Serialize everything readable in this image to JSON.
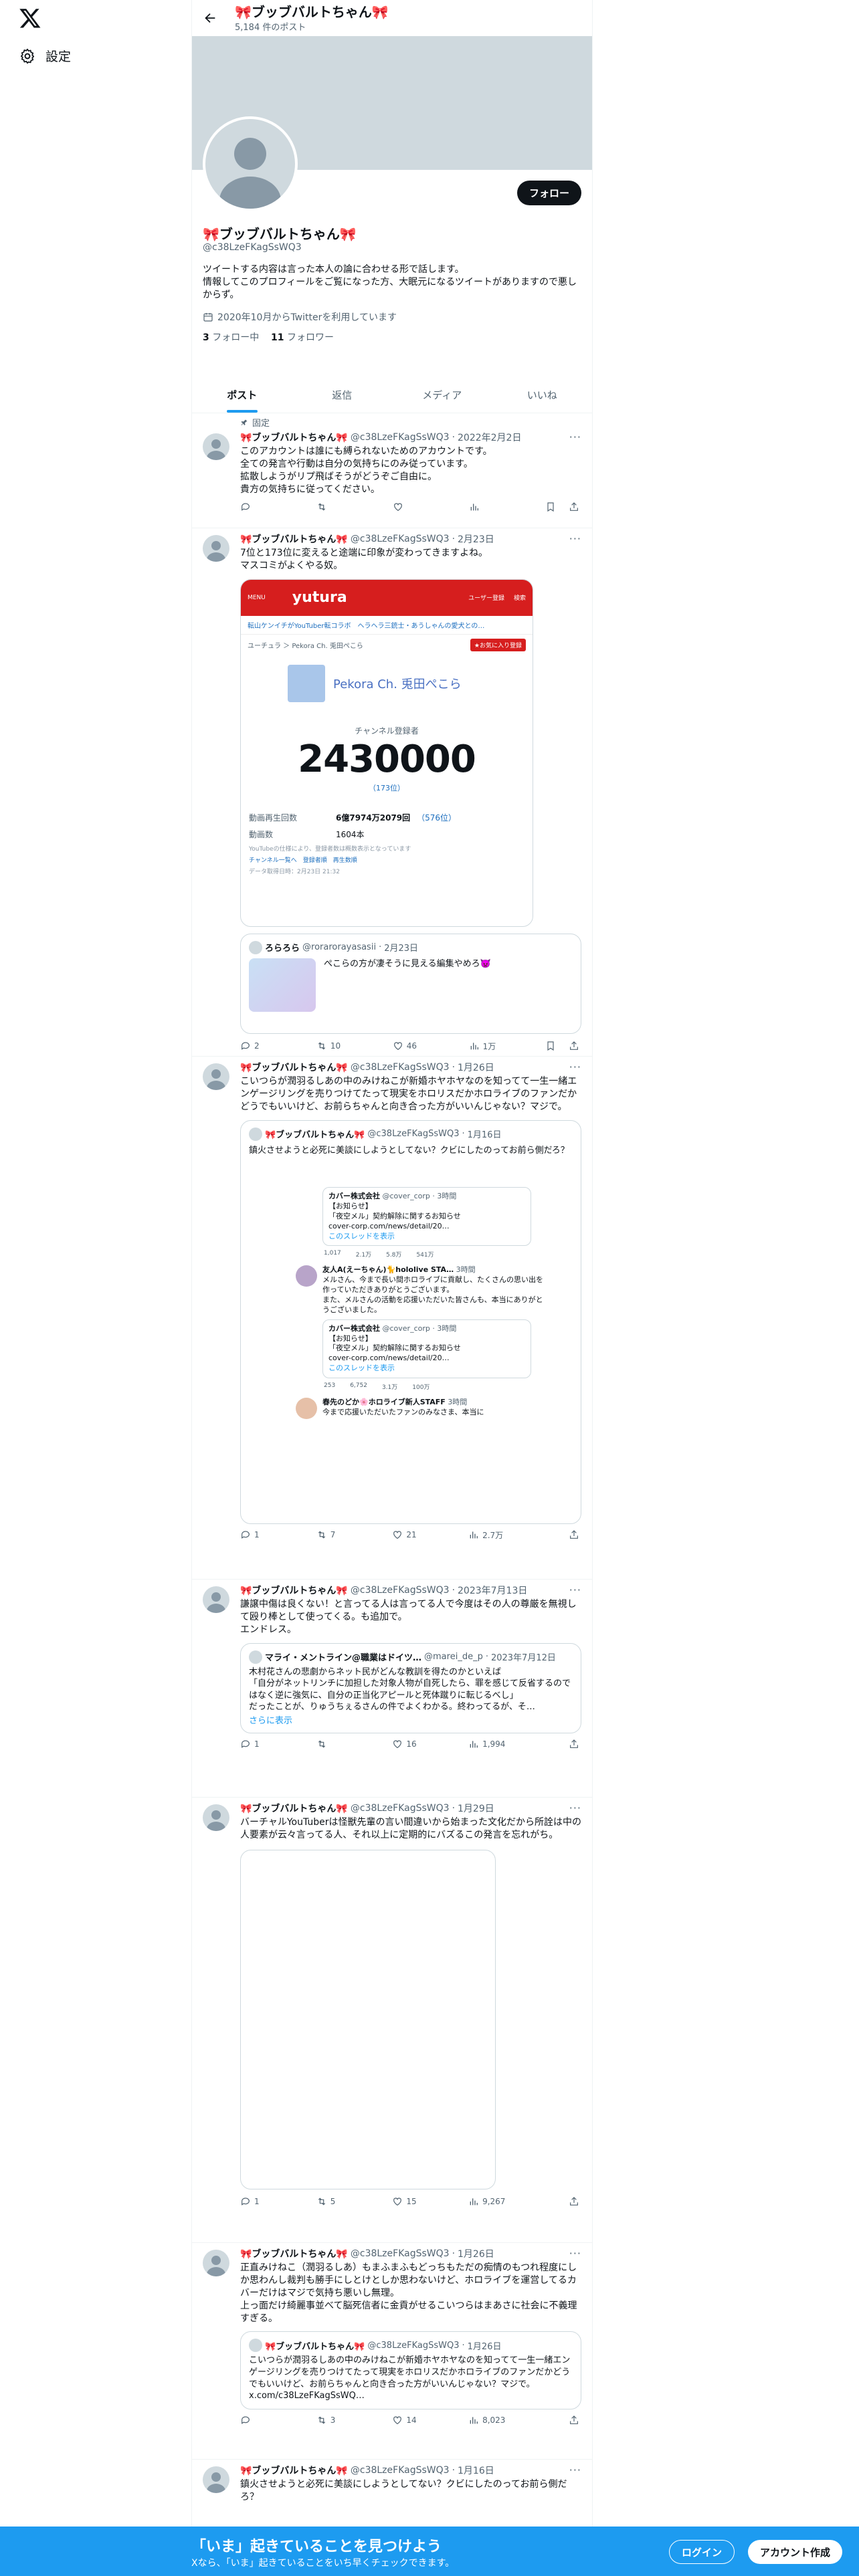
{
  "sidebar": {
    "settings_label": "設定"
  },
  "header": {
    "title": "🎀ブッブバルトちゃん🎀",
    "post_count": "5,184 件のポスト"
  },
  "profile": {
    "follow_label": "フォロー",
    "name": "🎀ブッブバルトちゃん🎀",
    "handle": "@c38LzeFKagSsWQ3",
    "bio": [
      "ツイートする内容は言った本人の論に合わせる形で話します。",
      "情報してこのプロフィールをご覧になった方、大眠元になるツイートがありますので悪しからず。"
    ],
    "joined": "2020年10月からTwitterを利用しています",
    "following_count": "3",
    "following_label": "フォロー中",
    "followers_count": "11",
    "followers_label": "フォロワー"
  },
  "tabs": [
    {
      "label": "ポスト"
    },
    {
      "label": "返信"
    },
    {
      "label": "メディア"
    },
    {
      "label": "いいね"
    }
  ],
  "pinned_label": "固定",
  "tweets": [
    {
      "name": "🎀ブッブバルトちゃん🎀",
      "handle": "@c38LzeFKagSsWQ3",
      "date": "2022年2月2日",
      "text": "このアカウントは誰にも縛られないためのアカウントです。\n全ての発言や行動は自分の気持ちにのみ従っています。\n拡散しようがリプ飛ばそうがどうぞご自由に。\n貴方の気持ちに従ってください。"
    },
    {
      "name": "🎀ブッブバルトちゃん🎀",
      "handle": "@c38LzeFKagSsWQ3",
      "date": "2月23日",
      "text": "7位と173位に変えると途端に印象が変わってきますよね。\nマスコミがよくやる奴。",
      "card": {
        "logo": "yutura",
        "user_label": "ユーザー登録",
        "search_label": "検索",
        "menu_label": "MENU",
        "nav": "転山ケンイチがYouTuber転コラボ　ヘラヘラ三銃士・あうしゃんの愛犬との…",
        "crumb": "ユーチュラ ＞ Pekora Ch. 兎田ぺこら",
        "fav_label": "★お気に入り登録",
        "channel": "Pekora Ch. 兎田ぺこら",
        "sub_label": "チャンネル登録者",
        "subscribers": "2430000",
        "rank": "（173位）",
        "views_label": "動画再生回数",
        "views_value": "6億7974万2079回",
        "views_rank": "（576位）",
        "videos_label": "動画数",
        "videos_value": "1604本",
        "note1": "YouTubeの仕様により、登録者数は概数表示となっています",
        "note2": "チャンネル一覧へ　登録者順　再生数順",
        "note3": "データ取得日時：2月23日 21:32"
      },
      "quote": {
        "name": "ろらろら",
        "handle": "@rorarorayasasii",
        "date": "2月23日",
        "text": "ぺこらの方が凄そうに見える編集やめろ👿"
      },
      "stats": {
        "reply": "2",
        "rt": "10",
        "like": "46",
        "views": "1万"
      }
    },
    {
      "name": "🎀ブッブバルトちゃん🎀",
      "handle": "@c38LzeFKagSsWQ3",
      "date": "1月26日",
      "text": "こいつらが潤羽るしあの中のみけねこが新婚ホヤホヤなのを知ってて一生一緒エンゲージリングを売りつけてたって現実をホロリスだかホロライブのファンだかどうでもいいけど、お前らちゃんと向き合った方がいいんじゃない？マジで。",
      "quote": {
        "name": "🎀ブッブバルトちゃん🎀",
        "handle": "@c38LzeFKagSsWQ3",
        "date": "1月16日",
        "text": "鎮火させようと必死に美談にしようとしてない？クビにしたのってお前ら側だろ？",
        "sub1": {
          "name": "カバー株式会社",
          "handle": "@cover_corp · 3時間",
          "text": "【お知らせ】\n「夜空メル」契約解除に関するお知らせ\ncover-corp.com/news/detail/20…",
          "link": "このスレッドを表示",
          "stats": [
            "1,017",
            "2.1万",
            "5.8万",
            "541万"
          ]
        },
        "reply": {
          "name": "友人A(えーちゃん)🐈hololive STA…",
          "meta": "3時間",
          "text": "メルさん、今まで長い間ホロライブに貢献し、たくさんの思い出を作っていただきありがとうございます。\nまた、メルさんの活動を応援いただいた皆さんも、本当にありがとうございました。"
        },
        "sub2": {
          "name": "カバー株式会社",
          "handle": "@cover_corp · 3時間",
          "text": "【お知らせ】\n「夜空メル」契約解除に関するお知らせ\ncover-corp.com/news/detail/20…",
          "link": "このスレッドを表示",
          "stats": [
            "253",
            "6,752",
            "3.1万",
            "100万"
          ]
        },
        "reply2": {
          "name": "春先のどか🌸ホロライブ新人STAFF",
          "meta": "3時間",
          "text": "今まで応援いただいたファンのみなさま、本当に"
        }
      },
      "stats": {
        "reply": "1",
        "rt": "7",
        "like": "21",
        "views": "2.7万"
      }
    },
    {
      "name": "🎀ブッブバルトちゃん🎀",
      "handle": "@c38LzeFKagSsWQ3",
      "date": "2023年7月13日",
      "text": "謙譲中傷は良くない！と言ってる人は言ってる人で今度はその人の尊厳を無視して殴り棒として使ってくる。も追加で。\nエンドレス。",
      "quote": {
        "name": "マライ・メントライン@職業はドイツ…",
        "handle": "@marei_de_p",
        "date": "2023年7月12日",
        "text": "木村花さんの悲劇からネット民がどんな教訓を得たのかといえば\n「自分がネットリンチに加担した対象人物が自死したら、罪を感じて反省するのではなく逆に強気に、自分の正当化アピールと死体蹴りに転じるべし」\nだったことが、りゅうちぇるさんの件でよくわかる。終わってるが、そ…",
        "more": "さらに表示"
      },
      "stats": {
        "reply": "1",
        "rt": "",
        "like": "16",
        "views": "1,994"
      }
    },
    {
      "name": "🎀ブッブバルトちゃん🎀",
      "handle": "@c38LzeFKagSsWQ3",
      "date": "1月29日",
      "text": "バーチャルYouTuberは怪獣先輩の言い間違いから始まった文化だから所詮は中の人要素が云々言ってる人、それ以上に定期的にバズるこの発言を忘れがち。",
      "stats": {
        "reply": "1",
        "rt": "5",
        "like": "15",
        "views": "9,267"
      }
    },
    {
      "name": "🎀ブッブバルトちゃん🎀",
      "handle": "@c38LzeFKagSsWQ3",
      "date": "1月26日",
      "text": "正直みけねこ（潤羽るしあ）もまふまふもどっちもただの痴情のもつれ程度にしか思わんし裁判も勝手にしとけとしか思わないけど、ホロライブを運営してるカバーだけはマジで気持ち悪いし無理。\n上っ面だけ綺麗事並べて脳死信者に金貢がせるこいつらはまあさに社会に不義理すぎる。",
      "quote": {
        "name": "🎀ブッブバルトちゃん🎀",
        "handle": "@c38LzeFKagSsWQ3",
        "date": "1月26日",
        "text": "こいつらが潤羽るしあの中のみけねこが新婚ホヤホヤなのを知ってて一生一緒エンゲージリングを売りつけてたって現実をホロリスだかホロライブのファンだかどうでもいいけど、お前らちゃんと向き合った方がいいんじゃない？マジで。 x.com/c38LzeFKagSsWQ…"
      },
      "stats": {
        "reply": "",
        "rt": "3",
        "like": "14",
        "views": "8,023"
      }
    },
    {
      "name": "🎀ブッブバルトちゃん🎀",
      "handle": "@c38LzeFKagSsWQ3",
      "date": "1月16日",
      "text": "鎮火させようと必死に美談にしようとしてない？クビにしたのってお前ら側だろ？"
    }
  ],
  "bottom": {
    "title": "「いま」起きていることを見つけよう",
    "subtitle": "Xなら、「いま」起きていることをいち早くチェックできます。",
    "login": "ログイン",
    "signup": "アカウント作成"
  }
}
